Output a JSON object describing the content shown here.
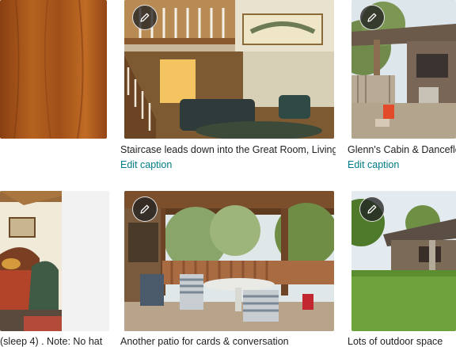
{
  "photos": [
    {
      "name": "wood-panel",
      "caption": "",
      "edit_link": ""
    },
    {
      "name": "great-room",
      "caption": "Staircase leads down into the Great Room, Living ...",
      "edit_link": "Edit caption",
      "edit_icon": "pencil-icon"
    },
    {
      "name": "glenns-cabin",
      "caption": "Glenn's Cabin & Danceflo",
      "edit_link": "Edit caption",
      "edit_icon": "pencil-icon"
    },
    {
      "name": "bedroom",
      "caption": "(sleep 4) . Note: No hat"
    },
    {
      "name": "patio",
      "caption": "Another patio for cards & conversation",
      "edit_icon": "pencil-icon"
    },
    {
      "name": "yard",
      "caption": "Lots of outdoor space",
      "edit_icon": "pencil-icon"
    }
  ],
  "colors": {
    "link": "#007a87",
    "text": "#222222",
    "edit_button_bg": "#222222"
  }
}
